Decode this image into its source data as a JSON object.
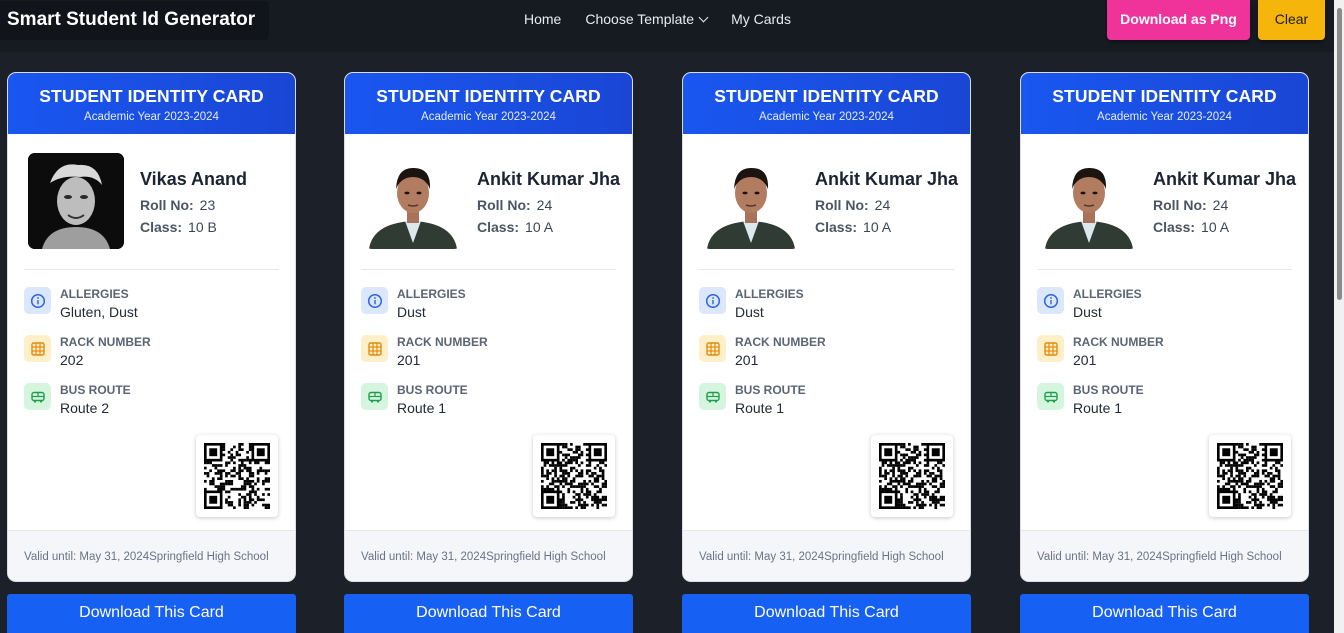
{
  "nav": {
    "brand": "Smart Student Id Generator",
    "links": [
      "Home",
      "Choose Template",
      "My Cards"
    ],
    "download_png": "Download as Png",
    "clear": "Clear"
  },
  "colors": {
    "accent": "#1660f4",
    "download_png": "#f0339a",
    "clear": "#f5b50b",
    "background": "#1b2029"
  },
  "cards": [
    {
      "title": "STUDENT IDENTITY CARD",
      "subtitle": "Academic Year 2023-2024",
      "name": "Vikas Anand",
      "roll_label": "Roll No:",
      "roll": "23",
      "class_label": "Class:",
      "class": "10 B",
      "allergies_label": "ALLERGIES",
      "allergies": "Gluten, Dust",
      "rack_label": "RACK NUMBER",
      "rack": "202",
      "bus_label": "BUS ROUTE",
      "bus": "Route 2",
      "footer": "Valid until: May 31, 2024Springfield High School",
      "download": "Download This Card"
    },
    {
      "title": "STUDENT IDENTITY CARD",
      "subtitle": "Academic Year 2023-2024",
      "name": "Ankit Kumar Jha",
      "roll_label": "Roll No:",
      "roll": "24",
      "class_label": "Class:",
      "class": "10 A",
      "allergies_label": "ALLERGIES",
      "allergies": "Dust",
      "rack_label": "RACK NUMBER",
      "rack": "201",
      "bus_label": "BUS ROUTE",
      "bus": "Route 1",
      "footer": "Valid until: May 31, 2024Springfield High School",
      "download": "Download This Card"
    },
    {
      "title": "STUDENT IDENTITY CARD",
      "subtitle": "Academic Year 2023-2024",
      "name": "Ankit Kumar Jha",
      "roll_label": "Roll No:",
      "roll": "24",
      "class_label": "Class:",
      "class": "10 A",
      "allergies_label": "ALLERGIES",
      "allergies": "Dust",
      "rack_label": "RACK NUMBER",
      "rack": "201",
      "bus_label": "BUS ROUTE",
      "bus": "Route 1",
      "footer": "Valid until: May 31, 2024Springfield High School",
      "download": "Download This Card"
    },
    {
      "title": "STUDENT IDENTITY CARD",
      "subtitle": "Academic Year 2023-2024",
      "name": "Ankit Kumar Jha",
      "roll_label": "Roll No:",
      "roll": "24",
      "class_label": "Class:",
      "class": "10 A",
      "allergies_label": "ALLERGIES",
      "allergies": "Dust",
      "rack_label": "RACK NUMBER",
      "rack": "201",
      "bus_label": "BUS ROUTE",
      "bus": "Route 1",
      "footer": "Valid until: May 31, 2024Springfield High School",
      "download": "Download This Card"
    }
  ]
}
